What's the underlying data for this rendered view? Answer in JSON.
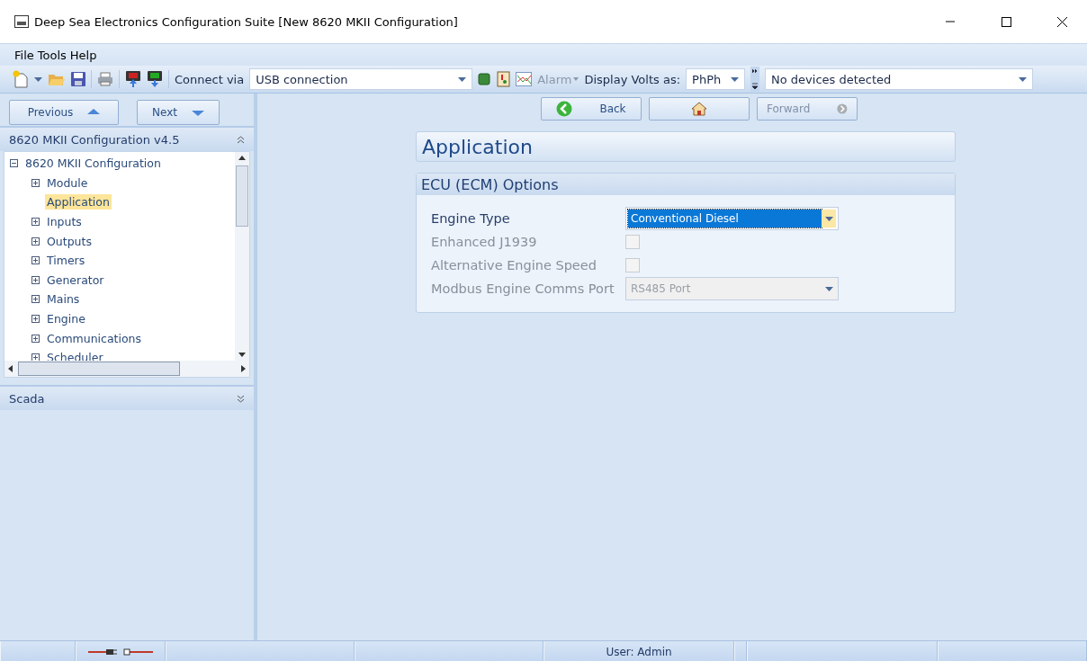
{
  "window": {
    "title": "Deep Sea Electronics Configuration Suite [New 8620 MKII Configuration]"
  },
  "menu": [
    "File",
    "Tools",
    "Help"
  ],
  "toolbar": {
    "connect_label": "Connect via",
    "connect_value": "USB connection",
    "alarm": {
      "label": "Alarm",
      "disabled": true
    },
    "volts_label": "Display Volts as:",
    "volts_value": "PhPh",
    "devices_value": "No devices detected"
  },
  "sidebar": {
    "previous": "Previous",
    "next": "Next",
    "panel_title": "8620 MKII Configuration v4.5",
    "tree": [
      {
        "label": "8620 MKII Configuration",
        "expanded": true,
        "selected": false,
        "children": [
          {
            "label": "Module",
            "expanded": false,
            "selected": false
          },
          {
            "label": "Application",
            "selected": true
          },
          {
            "label": "Inputs",
            "expanded": false,
            "selected": false
          },
          {
            "label": "Outputs",
            "expanded": false,
            "selected": false
          },
          {
            "label": "Timers",
            "expanded": false,
            "selected": false
          },
          {
            "label": "Generator",
            "expanded": false,
            "selected": false
          },
          {
            "label": "Mains",
            "expanded": false,
            "selected": false
          },
          {
            "label": "Engine",
            "expanded": false,
            "selected": false
          },
          {
            "label": "Communications",
            "expanded": false,
            "selected": false
          },
          {
            "label": "Scheduler",
            "expanded": false,
            "selected": false
          }
        ]
      }
    ],
    "scada_title": "Scada"
  },
  "nav": {
    "back": "Back",
    "forward": {
      "label": "Forward",
      "disabled": true
    }
  },
  "page": {
    "title": "Application",
    "section": "ECU (ECM) Options",
    "rows": [
      {
        "kind": "dropdown",
        "label": "Engine Type",
        "value": "Conventional Diesel",
        "disabled": false,
        "focused": true
      },
      {
        "kind": "checkbox",
        "label": "Enhanced J1939",
        "checked": false,
        "disabled": true
      },
      {
        "kind": "checkbox",
        "label": "Alternative Engine Speed",
        "checked": false,
        "disabled": true
      },
      {
        "kind": "dropdown",
        "label": "Modbus Engine Comms Port",
        "value": "RS485 Port",
        "disabled": true,
        "focused": false
      }
    ]
  },
  "status_bar": {
    "user": "User: Admin"
  }
}
